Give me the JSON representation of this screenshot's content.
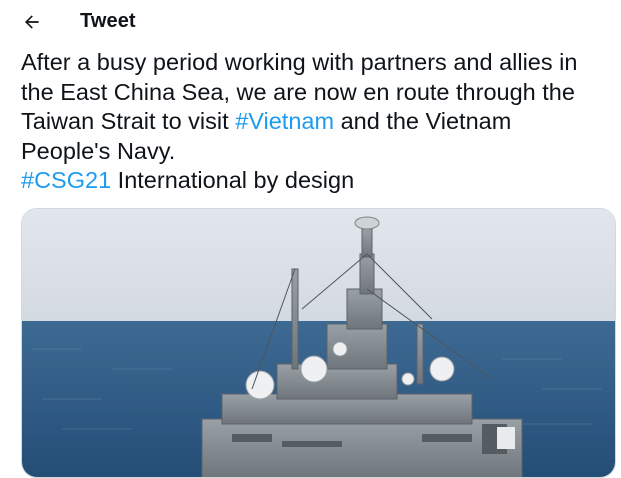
{
  "header": {
    "back_icon": "arrow-left-icon",
    "title": "Tweet"
  },
  "tweet": {
    "line1": "After a busy period working with partners and allies in",
    "line2": "the East China Sea, we are now en route through the",
    "line3_before": "Taiwan Strait to visit ",
    "line3_hashtag": "#Vietnam",
    "line3_after": " and the Vietnam",
    "line4": "People's Navy.",
    "line5_hashtag": "#CSG21",
    "line5_after": " International by design"
  },
  "colors": {
    "hashtag": "#1d9bf0",
    "text": "#0f1419",
    "sky": "#dfe4ea",
    "sea": "#2f5f8c"
  }
}
